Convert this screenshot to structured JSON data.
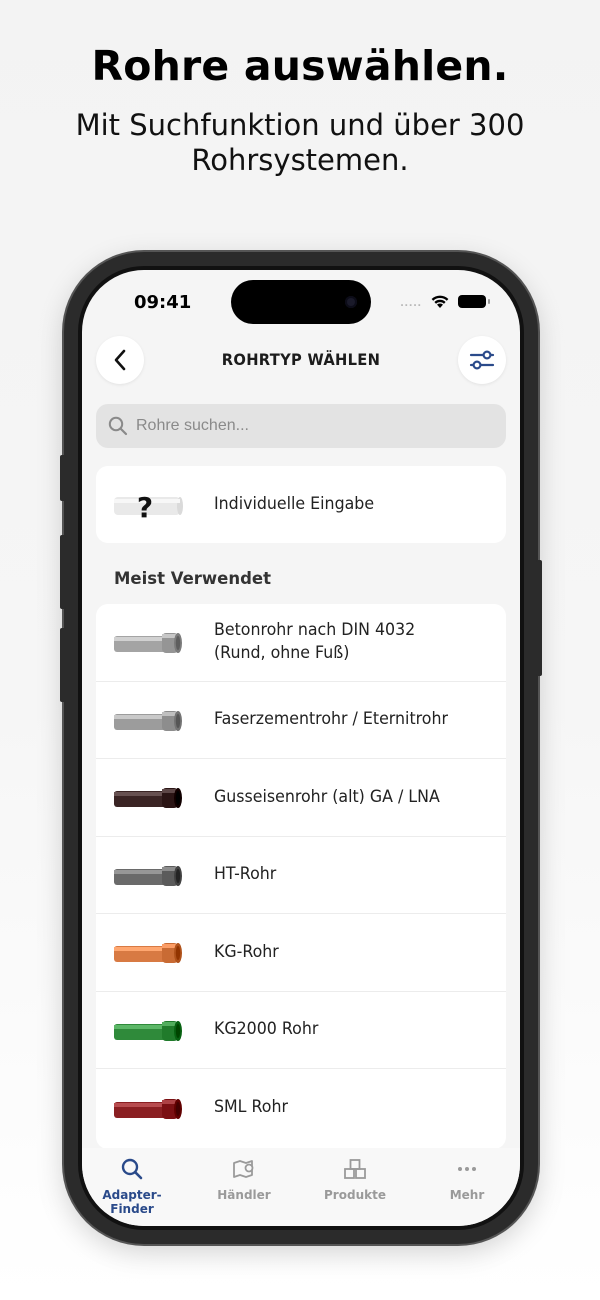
{
  "hero": {
    "title": "Rohre auswählen.",
    "subtitle": "Mit Suchfunktion und über 300 Rohrsystemen."
  },
  "status_bar": {
    "time": "09:41",
    "signal": "....."
  },
  "header": {
    "title": "ROHRTYP WÄHLEN"
  },
  "search": {
    "placeholder": "Rohre suchen..."
  },
  "custom_entry": {
    "label": "Individuelle Eingabe"
  },
  "section": {
    "title": "Meist Verwendet"
  },
  "pipes": [
    {
      "label": "Betonrohr nach DIN 4032 (Rund, ohne Fuß)",
      "icon": "concrete-pipe-icon",
      "color": "#a4a4a4"
    },
    {
      "label": "Faserzementrohr / Eternitrohr",
      "icon": "fiber-cement-pipe-icon",
      "color": "#9c9c9c"
    },
    {
      "label": "Gusseisenrohr (alt) GA / LNA",
      "icon": "cast-iron-pipe-icon",
      "color": "#3a2424"
    },
    {
      "label": "HT-Rohr",
      "icon": "ht-pipe-icon",
      "color": "#6a6a6a"
    },
    {
      "label": "KG-Rohr",
      "icon": "kg-pipe-icon",
      "color": "#d87a43"
    },
    {
      "label": "KG2000 Rohr",
      "icon": "kg2000-pipe-icon",
      "color": "#2f8a3a"
    },
    {
      "label": "SML Rohr",
      "icon": "sml-pipe-icon",
      "color": "#8a1f22"
    }
  ],
  "tabs": [
    {
      "label": "Adapter-Finder",
      "icon": "search-icon",
      "active": true
    },
    {
      "label": "Händler",
      "icon": "map-pin-icon",
      "active": false
    },
    {
      "label": "Produkte",
      "icon": "boxes-icon",
      "active": false
    },
    {
      "label": "Mehr",
      "icon": "more-dots-icon",
      "active": false
    }
  ],
  "colors": {
    "accent": "#2a4a8a",
    "inactive": "#9a9a9a"
  }
}
